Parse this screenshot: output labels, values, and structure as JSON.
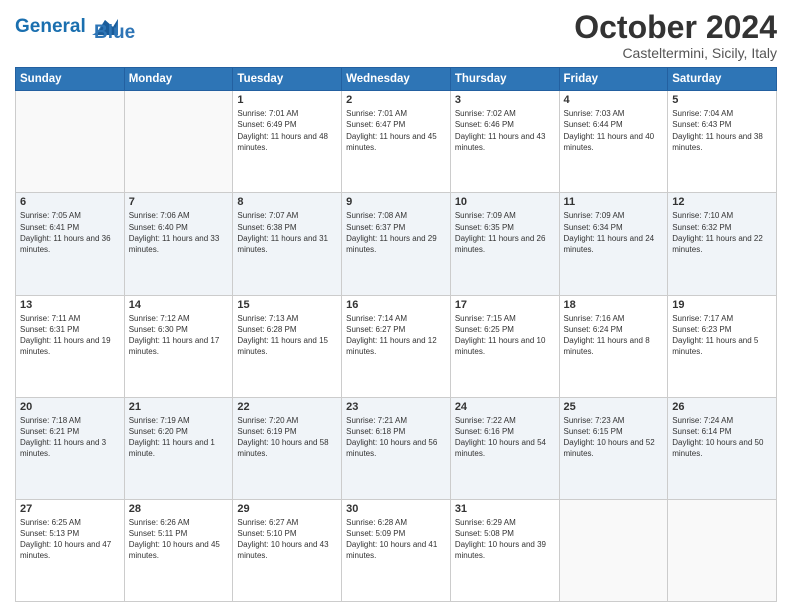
{
  "header": {
    "logo_line1": "General",
    "logo_line2": "Blue",
    "month": "October 2024",
    "location": "Casteltermini, Sicily, Italy"
  },
  "weekdays": [
    "Sunday",
    "Monday",
    "Tuesday",
    "Wednesday",
    "Thursday",
    "Friday",
    "Saturday"
  ],
  "weeks": [
    [
      {
        "day": "",
        "info": ""
      },
      {
        "day": "",
        "info": ""
      },
      {
        "day": "1",
        "info": "Sunrise: 7:01 AM\nSunset: 6:49 PM\nDaylight: 11 hours and 48 minutes."
      },
      {
        "day": "2",
        "info": "Sunrise: 7:01 AM\nSunset: 6:47 PM\nDaylight: 11 hours and 45 minutes."
      },
      {
        "day": "3",
        "info": "Sunrise: 7:02 AM\nSunset: 6:46 PM\nDaylight: 11 hours and 43 minutes."
      },
      {
        "day": "4",
        "info": "Sunrise: 7:03 AM\nSunset: 6:44 PM\nDaylight: 11 hours and 40 minutes."
      },
      {
        "day": "5",
        "info": "Sunrise: 7:04 AM\nSunset: 6:43 PM\nDaylight: 11 hours and 38 minutes."
      }
    ],
    [
      {
        "day": "6",
        "info": "Sunrise: 7:05 AM\nSunset: 6:41 PM\nDaylight: 11 hours and 36 minutes."
      },
      {
        "day": "7",
        "info": "Sunrise: 7:06 AM\nSunset: 6:40 PM\nDaylight: 11 hours and 33 minutes."
      },
      {
        "day": "8",
        "info": "Sunrise: 7:07 AM\nSunset: 6:38 PM\nDaylight: 11 hours and 31 minutes."
      },
      {
        "day": "9",
        "info": "Sunrise: 7:08 AM\nSunset: 6:37 PM\nDaylight: 11 hours and 29 minutes."
      },
      {
        "day": "10",
        "info": "Sunrise: 7:09 AM\nSunset: 6:35 PM\nDaylight: 11 hours and 26 minutes."
      },
      {
        "day": "11",
        "info": "Sunrise: 7:09 AM\nSunset: 6:34 PM\nDaylight: 11 hours and 24 minutes."
      },
      {
        "day": "12",
        "info": "Sunrise: 7:10 AM\nSunset: 6:32 PM\nDaylight: 11 hours and 22 minutes."
      }
    ],
    [
      {
        "day": "13",
        "info": "Sunrise: 7:11 AM\nSunset: 6:31 PM\nDaylight: 11 hours and 19 minutes."
      },
      {
        "day": "14",
        "info": "Sunrise: 7:12 AM\nSunset: 6:30 PM\nDaylight: 11 hours and 17 minutes."
      },
      {
        "day": "15",
        "info": "Sunrise: 7:13 AM\nSunset: 6:28 PM\nDaylight: 11 hours and 15 minutes."
      },
      {
        "day": "16",
        "info": "Sunrise: 7:14 AM\nSunset: 6:27 PM\nDaylight: 11 hours and 12 minutes."
      },
      {
        "day": "17",
        "info": "Sunrise: 7:15 AM\nSunset: 6:25 PM\nDaylight: 11 hours and 10 minutes."
      },
      {
        "day": "18",
        "info": "Sunrise: 7:16 AM\nSunset: 6:24 PM\nDaylight: 11 hours and 8 minutes."
      },
      {
        "day": "19",
        "info": "Sunrise: 7:17 AM\nSunset: 6:23 PM\nDaylight: 11 hours and 5 minutes."
      }
    ],
    [
      {
        "day": "20",
        "info": "Sunrise: 7:18 AM\nSunset: 6:21 PM\nDaylight: 11 hours and 3 minutes."
      },
      {
        "day": "21",
        "info": "Sunrise: 7:19 AM\nSunset: 6:20 PM\nDaylight: 11 hours and 1 minute."
      },
      {
        "day": "22",
        "info": "Sunrise: 7:20 AM\nSunset: 6:19 PM\nDaylight: 10 hours and 58 minutes."
      },
      {
        "day": "23",
        "info": "Sunrise: 7:21 AM\nSunset: 6:18 PM\nDaylight: 10 hours and 56 minutes."
      },
      {
        "day": "24",
        "info": "Sunrise: 7:22 AM\nSunset: 6:16 PM\nDaylight: 10 hours and 54 minutes."
      },
      {
        "day": "25",
        "info": "Sunrise: 7:23 AM\nSunset: 6:15 PM\nDaylight: 10 hours and 52 minutes."
      },
      {
        "day": "26",
        "info": "Sunrise: 7:24 AM\nSunset: 6:14 PM\nDaylight: 10 hours and 50 minutes."
      }
    ],
    [
      {
        "day": "27",
        "info": "Sunrise: 6:25 AM\nSunset: 5:13 PM\nDaylight: 10 hours and 47 minutes."
      },
      {
        "day": "28",
        "info": "Sunrise: 6:26 AM\nSunset: 5:11 PM\nDaylight: 10 hours and 45 minutes."
      },
      {
        "day": "29",
        "info": "Sunrise: 6:27 AM\nSunset: 5:10 PM\nDaylight: 10 hours and 43 minutes."
      },
      {
        "day": "30",
        "info": "Sunrise: 6:28 AM\nSunset: 5:09 PM\nDaylight: 10 hours and 41 minutes."
      },
      {
        "day": "31",
        "info": "Sunrise: 6:29 AM\nSunset: 5:08 PM\nDaylight: 10 hours and 39 minutes."
      },
      {
        "day": "",
        "info": ""
      },
      {
        "day": "",
        "info": ""
      }
    ]
  ]
}
